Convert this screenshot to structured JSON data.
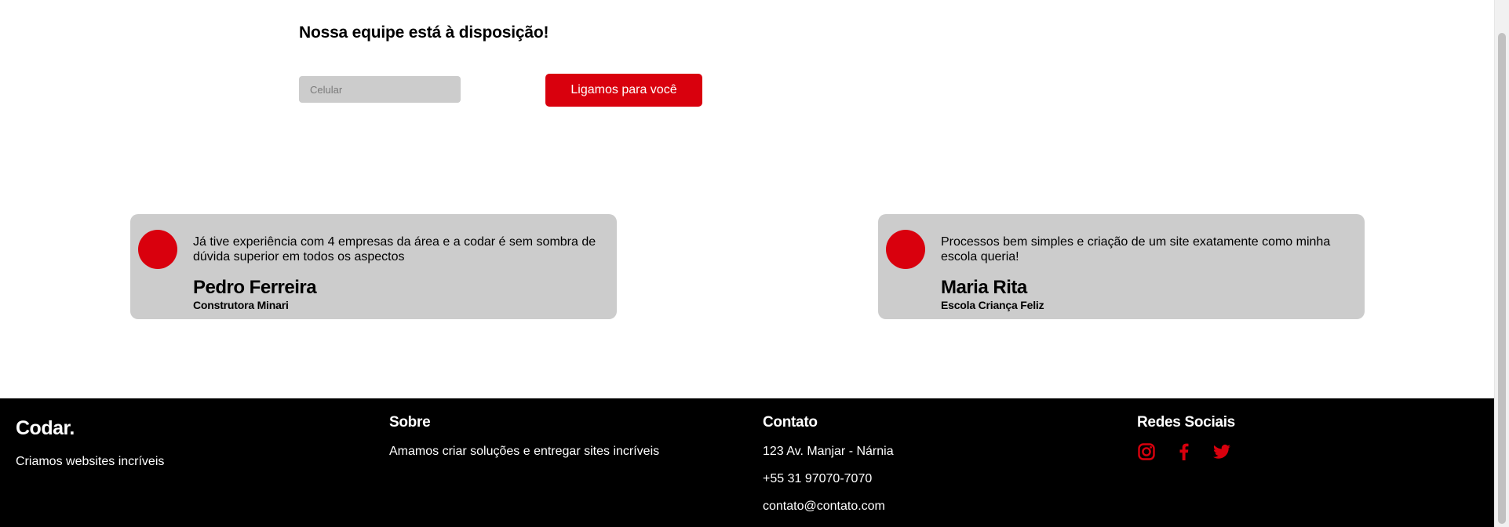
{
  "callback": {
    "title": "Nossa equipe está à disposição!",
    "phone_placeholder": "Celular",
    "button_label": "Ligamos para você"
  },
  "testimonials": [
    {
      "quote": "Já tive experiência com 4 empresas da área e a codar é sem sombra de dúvida superior em todos os aspectos",
      "name": "Pedro Ferreira",
      "company": "Construtora Minari"
    },
    {
      "quote": "Processos bem simples e criação de um site exatamente como minha escola queria!",
      "name": "Maria Rita",
      "company": "Escola Criança Feliz"
    }
  ],
  "footer": {
    "brand": "Codar.",
    "tagline": "Criamos websites incríveis",
    "about": {
      "heading": "Sobre",
      "text": "Amamos criar soluções e entregar sites incríveis"
    },
    "contact": {
      "heading": "Contato",
      "address": "123 Av. Manjar - Nárnia",
      "phone": "+55 31 97070-7070",
      "email": "contato@contato.com"
    },
    "social": {
      "heading": "Redes Sociais",
      "icons": [
        "instagram-icon",
        "facebook-icon",
        "twitter-icon"
      ]
    }
  },
  "colors": {
    "accent": "#d9000d",
    "card_background": "#cccccc",
    "footer_background": "#000000"
  }
}
